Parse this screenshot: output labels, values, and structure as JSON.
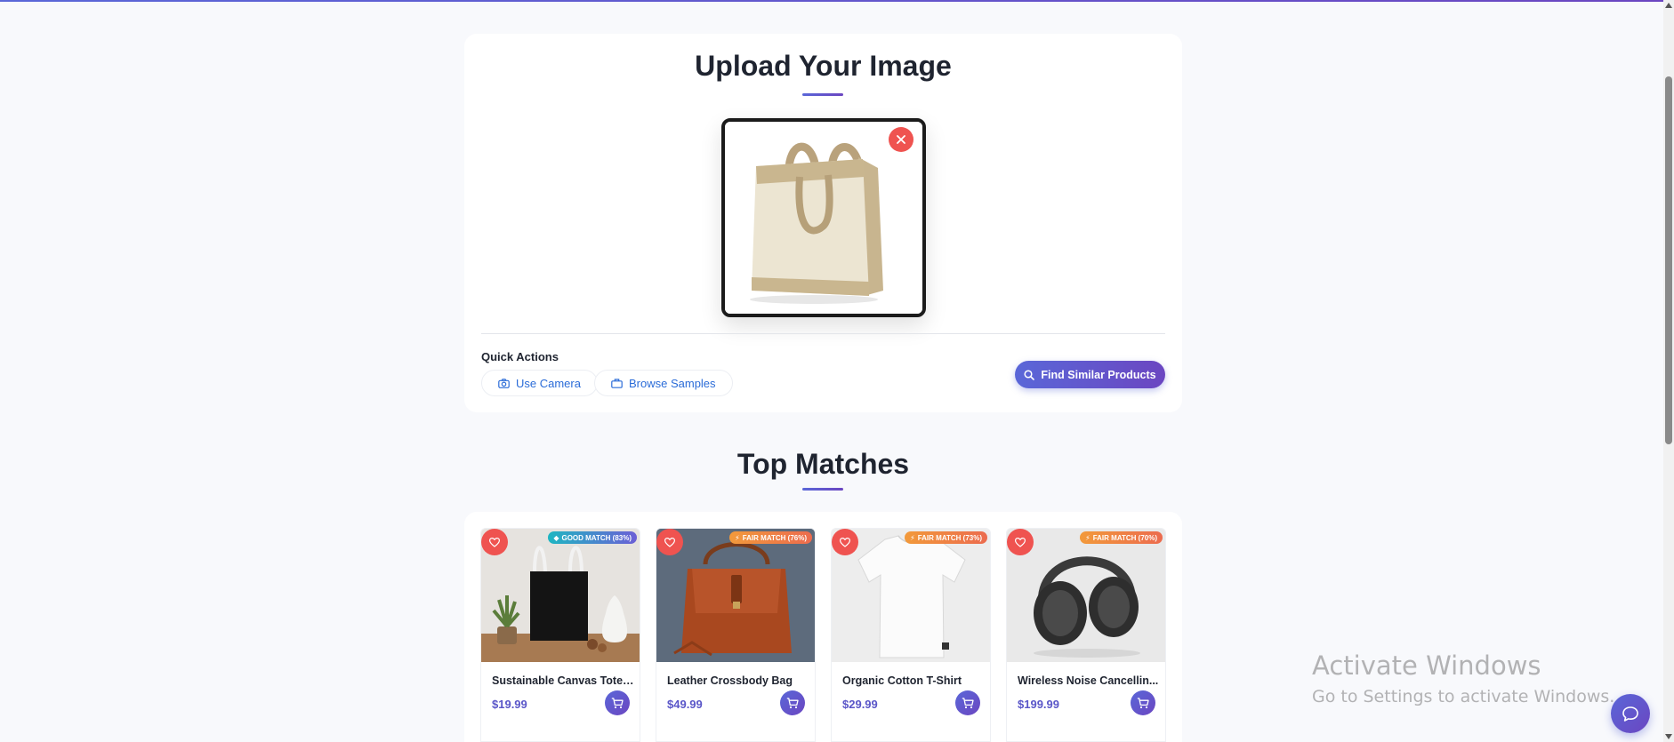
{
  "upload": {
    "title": "Upload Your Image",
    "quick_actions_label": "Quick Actions",
    "use_camera_label": "Use Camera",
    "browse_samples_label": "Browse Samples",
    "find_button_label": "Find Similar Products"
  },
  "matches": {
    "title": "Top Matches",
    "products": [
      {
        "name": "Sustainable Canvas Tote ...",
        "price": "$19.99",
        "badge": "GOOD MATCH (83%)",
        "badge_color": "#2bb3c0"
      },
      {
        "name": "Leather Crossbody Bag",
        "price": "$49.99",
        "badge": "FAIR MATCH (76%)",
        "badge_color": "#f08a3c"
      },
      {
        "name": "Organic Cotton T-Shirt",
        "price": "$29.99",
        "badge": "FAIR MATCH (73%)",
        "badge_color": "#f08a3c"
      },
      {
        "name": "Wireless Noise Cancellin...",
        "price": "$199.99",
        "badge": "FAIR MATCH (70%)",
        "badge_color": "#f08a3c"
      }
    ]
  },
  "watermark": {
    "line1": "Activate Windows",
    "line2": "Go to Settings to activate Windows."
  },
  "colors": {
    "accent": "#5a67d8",
    "accent_dark": "#6b46c1",
    "remove": "#ef5350",
    "link": "#2b6cd8"
  }
}
